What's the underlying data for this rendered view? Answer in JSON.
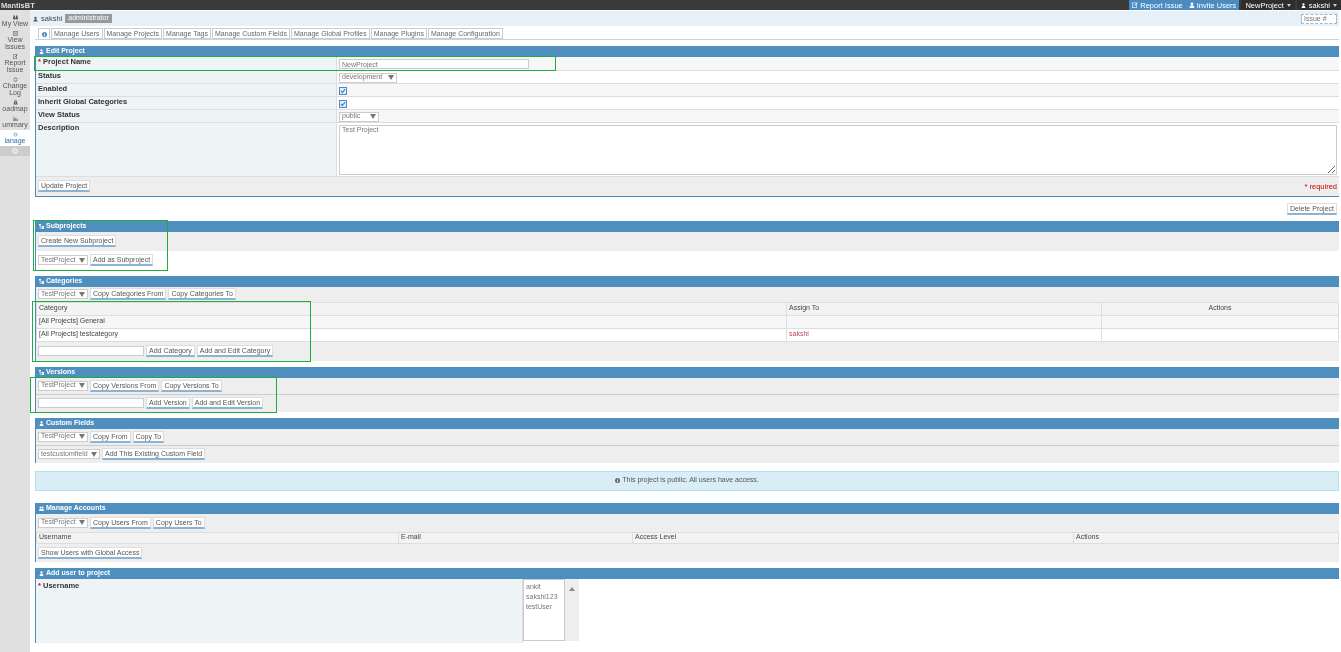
{
  "app": {
    "title": "MantisBT"
  },
  "navbar": {
    "buttons": [
      "Report Issue",
      "Invite Users"
    ],
    "project": "NewProject",
    "user": "sakshi"
  },
  "sidebar": {
    "items": [
      {
        "label": "My View",
        "selected": false
      },
      {
        "label": "View Issues",
        "selected": false
      },
      {
        "label": "Report Issue",
        "selected": false
      },
      {
        "label": "Change Log",
        "selected": false
      },
      {
        "label": "oadmap",
        "selected": false
      },
      {
        "label": "ummary",
        "selected": false
      },
      {
        "label": "lanage",
        "selected": true
      }
    ]
  },
  "breadcrumb": {
    "user": "sakshi",
    "role": "administrator",
    "search_placeholder": "Issue #"
  },
  "tabs": [
    {
      "kind": "icon",
      "selected": true
    },
    {
      "kind": "text",
      "label": "Manage Users",
      "selected": false
    },
    {
      "kind": "text",
      "label": "Manage Projects",
      "selected": false
    },
    {
      "kind": "text",
      "label": "Manage Tags",
      "selected": false
    },
    {
      "kind": "text",
      "label": "Manage Custom Fields",
      "selected": false
    },
    {
      "kind": "text",
      "label": "Manage Global Profiles",
      "selected": false
    },
    {
      "kind": "text",
      "label": "Manage Plugins",
      "selected": false
    },
    {
      "kind": "text",
      "label": "Manage Configuration",
      "selected": false
    }
  ],
  "edit_project": {
    "title": "Edit Project",
    "required_marker": "*",
    "fields": [
      {
        "kind": "text",
        "label": "Project Name",
        "required": true,
        "value": "NewProject"
      },
      {
        "kind": "select",
        "label": "Status",
        "required": false,
        "value": "development"
      },
      {
        "kind": "checkbox",
        "label": "Enabled",
        "required": false,
        "checked": true
      },
      {
        "kind": "checkbox",
        "label": "Inherit Global Categories",
        "required": false,
        "checked": true
      },
      {
        "kind": "select",
        "label": "View Status",
        "required": false,
        "value": "public"
      },
      {
        "kind": "textarea",
        "label": "Description",
        "required": false,
        "value": "Test Project"
      }
    ],
    "submit": "Update Project",
    "required_note": "* required"
  },
  "delete_button": "Delete Project",
  "subprojects": {
    "title": "Subprojects",
    "create_button": "Create New Subproject",
    "select_value": "TestProject",
    "add_button": "Add as Subproject"
  },
  "categories": {
    "title": "Categories",
    "select_value": "TestProject",
    "copy_buttons": [
      "Copy Categories From",
      "Copy Categories To"
    ],
    "columns": [
      "Category",
      "Assign To",
      "Actions"
    ],
    "rows": [
      {
        "category": "[All Projects] General"
      },
      {
        "category": "[All Projects] testcategory",
        "assign_to": "sakshi"
      }
    ],
    "add_buttons": [
      "Add Category",
      "Add and Edit Category"
    ]
  },
  "versions": {
    "title": "Versions",
    "select_value": "TestProject",
    "copy_buttons": [
      "Copy Versions From",
      "Copy Versions To"
    ],
    "add_buttons": [
      "Add Version",
      "Add and Edit Version"
    ]
  },
  "custom_fields": {
    "title": "Custom Fields",
    "select_value": "TestProject",
    "copy_buttons": [
      "Copy From",
      "Copy To"
    ],
    "field_select_value": "testcustomfield",
    "add_button": "Add This Existing Custom Field"
  },
  "notice": "This project is public. All users have access.",
  "manage_accounts": {
    "title": "Manage Accounts",
    "select_value": "TestProject",
    "copy_buttons": [
      "Copy Users From",
      "Copy Users To"
    ],
    "columns": [
      "Username",
      "E-mail",
      "Access Level",
      "Actions"
    ],
    "show_button": "Show Users with Global Access"
  },
  "add_user": {
    "title": "Add user to project",
    "label": "Username",
    "required": true,
    "required_marker": "*",
    "options": [
      "ankit",
      "sakshi123",
      "testUser"
    ]
  }
}
